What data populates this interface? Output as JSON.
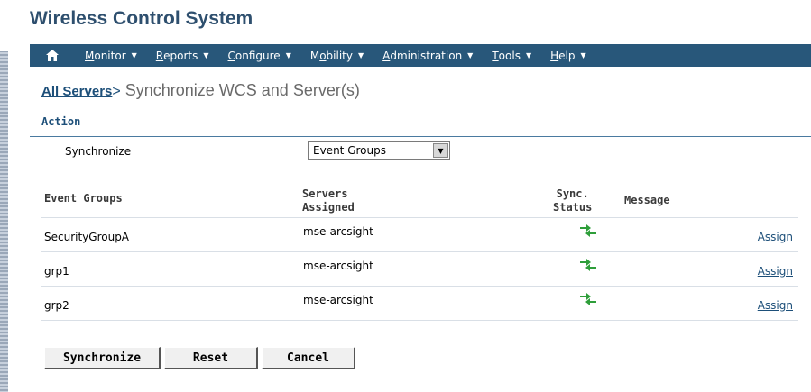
{
  "app": {
    "title": "Wireless Control System"
  },
  "nav": {
    "home_icon": "home-icon",
    "items": [
      {
        "pre": "",
        "ul": "M",
        "post": "onitor"
      },
      {
        "pre": "",
        "ul": "R",
        "post": "eports"
      },
      {
        "pre": "",
        "ul": "C",
        "post": "onfigure"
      },
      {
        "pre": "M",
        "ul": "o",
        "post": "bility"
      },
      {
        "pre": "",
        "ul": "A",
        "post": "dministration"
      },
      {
        "pre": "",
        "ul": "T",
        "post": "ools"
      },
      {
        "pre": "",
        "ul": "H",
        "post": "elp"
      }
    ]
  },
  "breadcrumb": {
    "link": "All Servers",
    "separator": ">",
    "title": " Synchronize WCS and Server(s)"
  },
  "action": {
    "section_title": "Action",
    "sync_label": "Synchronize",
    "select_value": "Event Groups"
  },
  "table": {
    "headers": {
      "name": "Event Groups",
      "servers_line1": "Servers",
      "servers_line2": "Assigned",
      "sync_line1": "Sync.",
      "sync_line2": "Status",
      "message": "Message"
    },
    "rows": [
      {
        "name": "SecurityGroupA",
        "server": "mse-arcsight",
        "message": "",
        "action": "Assign"
      },
      {
        "name": "grp1",
        "server": "mse-arcsight",
        "message": "",
        "action": "Assign"
      },
      {
        "name": "grp2",
        "server": "mse-arcsight",
        "message": "",
        "action": "Assign"
      }
    ]
  },
  "buttons": {
    "synchronize": "Synchronize",
    "reset": "Reset",
    "cancel": "Cancel"
  },
  "colors": {
    "navbar": "#28577a",
    "title": "#2e4f6e",
    "link": "#1d4f79",
    "sync_arrow": "#2e9e3a"
  }
}
